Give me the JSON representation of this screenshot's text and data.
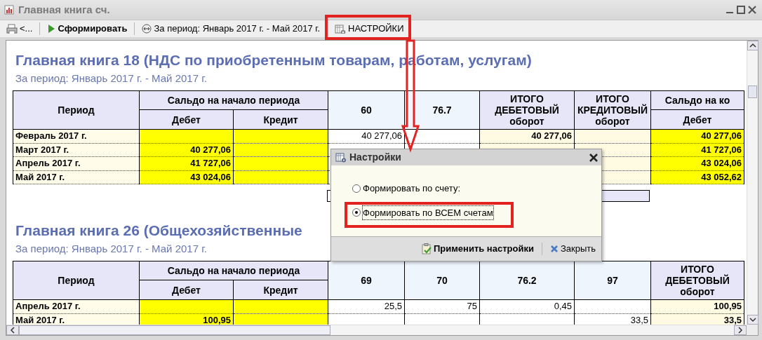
{
  "window": {
    "title": "Главная книга сч."
  },
  "toolbar": [
    {
      "kind": "back",
      "label": "<..."
    },
    {
      "kind": "run",
      "label": "Сформировать"
    },
    {
      "kind": "period",
      "label": "За период: Январь 2017 г. - Май 2017 г."
    },
    {
      "kind": "settings",
      "label": "НАСТРОЙКИ"
    }
  ],
  "reports": [
    {
      "title": "Главная книга 18 (НДС по приобретенным товарам, работам, услугам)",
      "period": "За период: Январь 2017 г. - Май 2017 г.",
      "columns": [
        {
          "kind": "period",
          "label": "Период"
        },
        {
          "kind": "balance",
          "label": "Дебет",
          "group": "Сальдо на начало периода"
        },
        {
          "kind": "balance",
          "label": "Кредит",
          "in_group": true
        },
        {
          "kind": "account",
          "label": "60"
        },
        {
          "kind": "account",
          "label": "76.7"
        },
        {
          "kind": "total",
          "label": "ИТОГО ДЕБЕТОВЫЙ",
          "sublabel": "оборот"
        },
        {
          "kind": "total",
          "label": "ИТОГО КРЕДИТОВЫЙ оборот"
        },
        {
          "kind": "balance",
          "label": "Дебет",
          "group": "Сальдо на ко"
        }
      ],
      "rows": [
        {
          "cells": [
            "Февраль 2017 г.",
            null,
            null,
            "40 277,06",
            null,
            "40 277,06",
            null,
            "40 277,06"
          ]
        },
        {
          "cells": [
            "Март 2017 г.",
            "40 277,06",
            null,
            null,
            null,
            null,
            null,
            "41 727,06"
          ]
        },
        {
          "cells": [
            "Апрель 2017 г.",
            "41 727,06",
            null,
            null,
            null,
            null,
            null,
            "43 024,06"
          ]
        },
        {
          "cells": [
            "Май 2017 г.",
            "43 024,06",
            null,
            null,
            null,
            null,
            null,
            "43 052,62"
          ]
        }
      ],
      "summary_frame": true
    },
    {
      "title": "Главная книга 26 (Общехозяйственные",
      "period": "За период: Январь 2017 г. - Май 2017 г.",
      "columns": [
        {
          "kind": "period",
          "label": "Период"
        },
        {
          "kind": "balance",
          "label": "Дебет",
          "group": "Сальдо на начало периода"
        },
        {
          "kind": "balance",
          "label": "Кредит",
          "in_group": true
        },
        {
          "kind": "account",
          "label": "69"
        },
        {
          "kind": "account",
          "label": "70"
        },
        {
          "kind": "account",
          "label": "76.2"
        },
        {
          "kind": "account",
          "label": "97"
        },
        {
          "kind": "total",
          "label": "ИТОГО ДЕБЕТОВЫЙ",
          "sublabel": "оборот"
        }
      ],
      "rows": [
        {
          "cells": [
            "Апрель 2017 г.",
            null,
            null,
            "25,5",
            "75",
            "0,45",
            null,
            "100,95"
          ]
        },
        {
          "cells": [
            "Май 2017 г.",
            "100,95",
            null,
            null,
            null,
            null,
            "33,5",
            "33,5"
          ]
        }
      ]
    }
  ],
  "dialog": {
    "title": "Настройки",
    "options": [
      {
        "label": "Формировать по счету:",
        "selected": false,
        "focused": false
      },
      {
        "label": "Формировать по ВСЕМ счетам",
        "selected": true,
        "focused": true
      }
    ],
    "buttons": [
      {
        "kind": "apply",
        "label": "Применить настройки"
      },
      {
        "kind": "close",
        "label": "Закрыть"
      }
    ]
  }
}
